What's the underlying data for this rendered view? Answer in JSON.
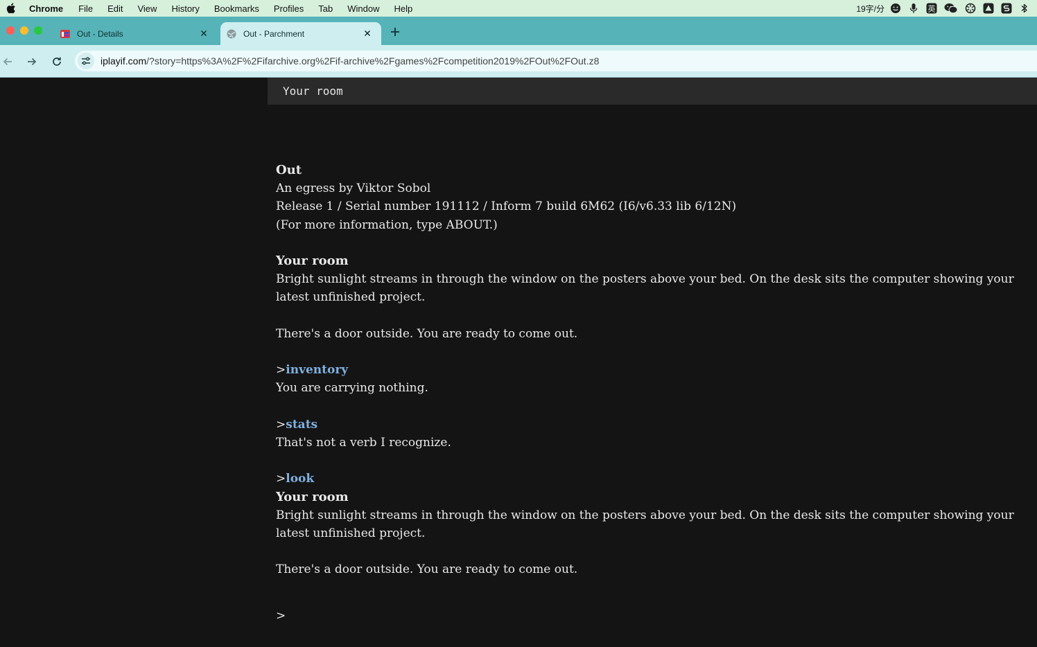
{
  "menubar": {
    "app_name": "Chrome",
    "items": [
      "File",
      "Edit",
      "View",
      "History",
      "Bookmarks",
      "Profiles",
      "Tab",
      "Window",
      "Help"
    ],
    "status_text": "19字/分",
    "status_icons": [
      "smiley-icon",
      "microphone-icon",
      "input-method-icon",
      "wechat-icon",
      "chatgpt-icon",
      "drive-icon",
      "s-app-icon",
      "bluetooth-icon"
    ],
    "input_method_glyph": "英"
  },
  "tabs": [
    {
      "title": "Out - Details",
      "active": false,
      "icon": "ifdb-favicon-icon"
    },
    {
      "title": "Out - Parchment",
      "active": true,
      "icon": "globe-favicon-icon"
    }
  ],
  "toolbar": {
    "url_host": "iplayif.com",
    "url_rest": "/?story=https%3A%2F%2Fifarchive.org%2Fif-archive%2Fgames%2Fcompetition2019%2FOut%2FOut.z8"
  },
  "game": {
    "status_location": "Your room",
    "title": "Out",
    "byline": "An egress by Viktor Sobol",
    "release": "Release 1 / Serial number 191112 / Inform 7 build 6M62 (I6/v6.33 lib 6/12N)",
    "info": "(For more information, type ABOUT.)",
    "room_name_1": "Your room",
    "room_desc_1": "Bright sunlight streams in through the window on the posters above your bed. On the desk sits the computer showing your latest unfinished project.",
    "door_text_1": "There's a door outside. You are ready to come out.",
    "prompt_char": ">",
    "cmd_1": "inventory",
    "resp_1": "You are carrying nothing.",
    "cmd_2": "stats",
    "resp_2": "That's not a verb I recognize.",
    "cmd_3": "look",
    "room_name_2": "Your room",
    "room_desc_2": "Bright sunlight streams in through the window on the posters above your bed. On the desk sits the computer showing your latest unfinished project.",
    "door_text_2": "There's a door outside. You are ready to come out."
  },
  "colors": {
    "menubar_bg": "#d6f0dc",
    "tabstrip_bg": "#56b3b8",
    "toolbar_bg": "#cfeef0",
    "page_bg": "#141414",
    "command_text": "#7fb0e0"
  }
}
